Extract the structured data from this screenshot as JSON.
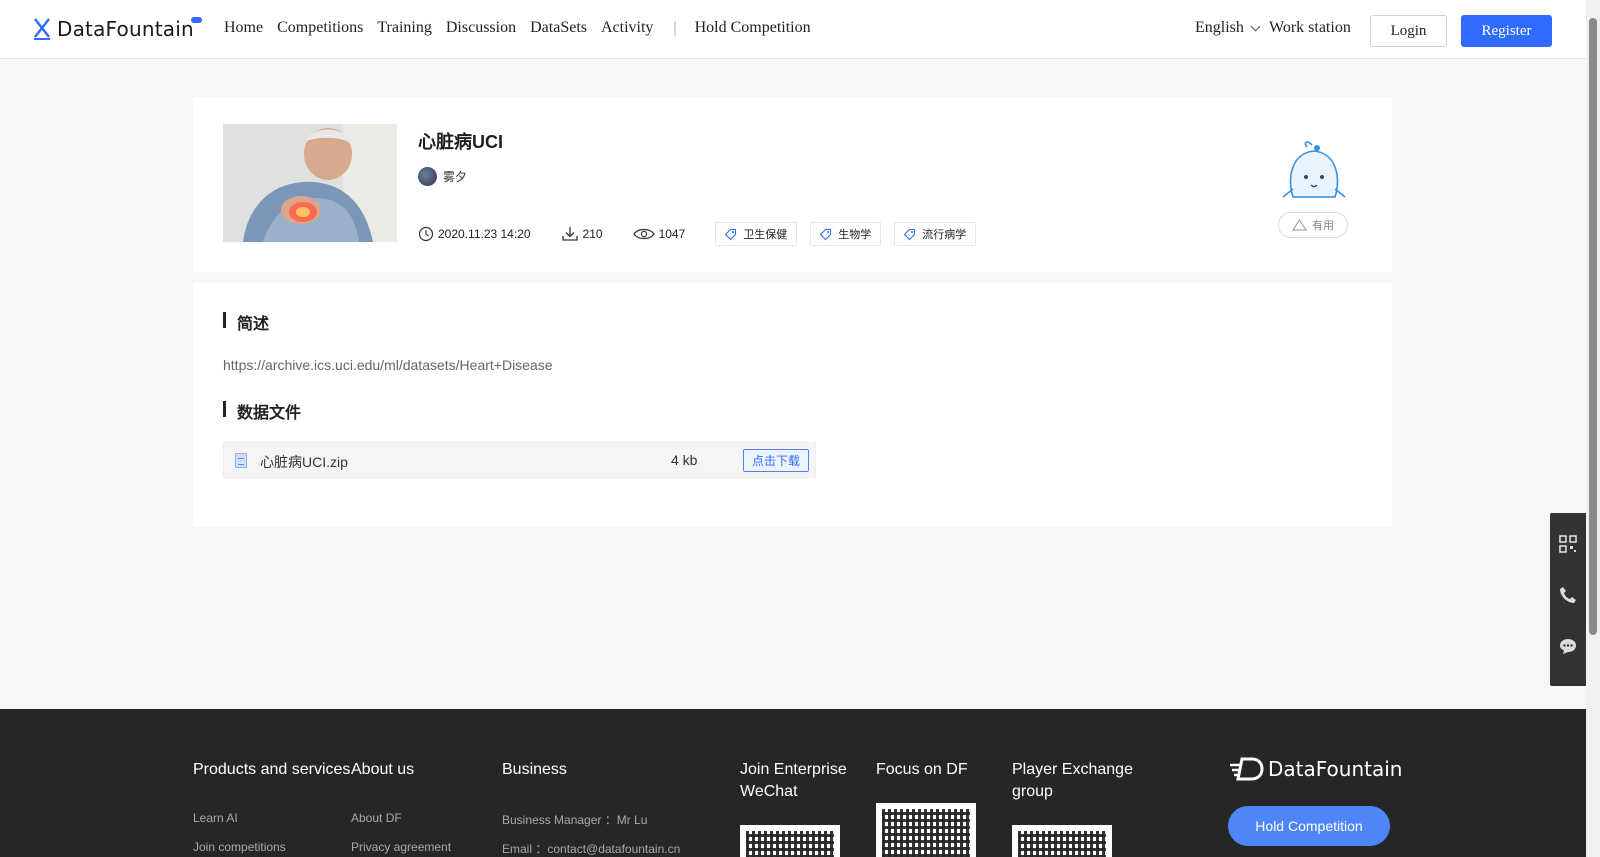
{
  "header": {
    "logo_text": "DataFountain",
    "nav": [
      "Home",
      "Competitions",
      "Training",
      "Discussion",
      "DataSets",
      "Activity"
    ],
    "nav_separator": "|",
    "hold_competition": "Hold Competition",
    "language": "English",
    "work_station": "Work station",
    "login": "Login",
    "register": "Register",
    "accent_color": "#2f6bff"
  },
  "dataset": {
    "title": "心脏病UCI",
    "author": "雾夕",
    "date": "2020.11.23 14:20",
    "downloads": "210",
    "views": "1047",
    "tags": [
      "卫生保健",
      "生物学",
      "流行病学"
    ],
    "useful_label": "有用"
  },
  "description": {
    "section_title": "简述",
    "text": "https://archive.ics.uci.edu/ml/datasets/Heart+Disease"
  },
  "files": {
    "section_title": "数据文件",
    "items": [
      {
        "name": "心脏病UCI.zip",
        "size": "4 kb",
        "download_label": "点击下载"
      }
    ]
  },
  "side_tools": [
    "qrcode-icon",
    "phone-icon",
    "chat-icon"
  ],
  "footer": {
    "products_title": "Products and services",
    "products_links": [
      "Learn AI",
      "Join competitions"
    ],
    "about_title": "About us",
    "about_links": [
      "About DF",
      "Privacy agreement"
    ],
    "business_title": "Business",
    "business_links": [
      "Business Manager ：Mr Lu",
      "Email ：contact@datafountain.cn"
    ],
    "wechat_title": "Join Enterprise WeChat",
    "focus_title": "Focus on DF",
    "player_title": "Player Exchange group",
    "logo_text": "DataFountain",
    "hold_competition": "Hold Competition"
  }
}
